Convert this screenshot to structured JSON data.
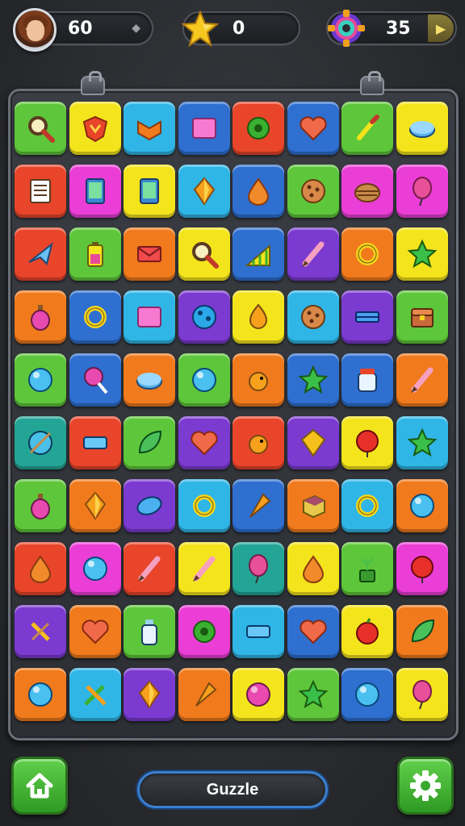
{
  "hud": {
    "player_score": "60",
    "stars_count": "0",
    "coins_count": "35"
  },
  "title": "Guzzle",
  "colors": {
    "green": "#5ec63a",
    "yellow": "#f4e41c",
    "cyan": "#2fb6e6",
    "blue": "#2e6fd0",
    "red": "#e8452a",
    "orange": "#f07a1c",
    "magenta": "#ea3ed6",
    "purple": "#7b3ad0",
    "teal": "#23a596"
  },
  "board": {
    "rows": [
      [
        [
          "green",
          "magnifier"
        ],
        [
          "yellow",
          "emblem"
        ],
        [
          "cyan",
          "chevron"
        ],
        [
          "blue",
          "square-pink"
        ],
        [
          "red",
          "gear"
        ],
        [
          "blue",
          "heart"
        ],
        [
          "green",
          "brush"
        ],
        [
          "yellow",
          "disc"
        ]
      ],
      [
        [
          "red",
          "notepad"
        ],
        [
          "magenta",
          "phone"
        ],
        [
          "yellow",
          "phone"
        ],
        [
          "cyan",
          "gem"
        ],
        [
          "blue",
          "drop"
        ],
        [
          "green",
          "cookie"
        ],
        [
          "magenta",
          "basket"
        ],
        [
          "magenta",
          "balloon"
        ]
      ],
      [
        [
          "red",
          "plane"
        ],
        [
          "green",
          "battery"
        ],
        [
          "orange",
          "envelope"
        ],
        [
          "yellow",
          "magnifier"
        ],
        [
          "blue",
          "chart"
        ],
        [
          "purple",
          "pencil"
        ],
        [
          "orange",
          "ring"
        ],
        [
          "yellow",
          "star"
        ]
      ],
      [
        [
          "orange",
          "potion"
        ],
        [
          "blue",
          "ring"
        ],
        [
          "cyan",
          "square-pink"
        ],
        [
          "purple",
          "ball-dots"
        ],
        [
          "yellow",
          "bulb"
        ],
        [
          "cyan",
          "cookie"
        ],
        [
          "purple",
          "box-flat"
        ],
        [
          "green",
          "chest"
        ]
      ],
      [
        [
          "green",
          "orb"
        ],
        [
          "blue",
          "lollipop"
        ],
        [
          "orange",
          "disc"
        ],
        [
          "green",
          "orb"
        ],
        [
          "orange",
          "bird"
        ],
        [
          "blue",
          "star"
        ],
        [
          "blue",
          "jar"
        ],
        [
          "orange",
          "pencil"
        ]
      ],
      [
        [
          "teal",
          "globe"
        ],
        [
          "red",
          "bar"
        ],
        [
          "green",
          "leaf"
        ],
        [
          "purple",
          "heart"
        ],
        [
          "red",
          "bird"
        ],
        [
          "purple",
          "kite"
        ],
        [
          "yellow",
          "ball-red"
        ],
        [
          "cyan",
          "star"
        ]
      ],
      [
        [
          "green",
          "potion"
        ],
        [
          "orange",
          "gem"
        ],
        [
          "purple",
          "bean"
        ],
        [
          "cyan",
          "ring"
        ],
        [
          "blue",
          "cone"
        ],
        [
          "orange",
          "cube"
        ],
        [
          "cyan",
          "ring"
        ],
        [
          "orange",
          "orb"
        ]
      ],
      [
        [
          "red",
          "drop"
        ],
        [
          "magenta",
          "orb"
        ],
        [
          "red",
          "pencil"
        ],
        [
          "yellow",
          "pencil"
        ],
        [
          "teal",
          "balloon"
        ],
        [
          "yellow",
          "drop"
        ],
        [
          "green",
          "plant"
        ],
        [
          "magenta",
          "ball-red"
        ]
      ],
      [
        [
          "purple",
          "pin"
        ],
        [
          "orange",
          "heart"
        ],
        [
          "green",
          "bottle"
        ],
        [
          "magenta",
          "gear"
        ],
        [
          "cyan",
          "bar"
        ],
        [
          "blue",
          "heart"
        ],
        [
          "yellow",
          "apple"
        ],
        [
          "orange",
          "leaf"
        ]
      ],
      [
        [
          "orange",
          "orb"
        ],
        [
          "cyan",
          "tools"
        ],
        [
          "purple",
          "gem"
        ],
        [
          "orange",
          "cone"
        ],
        [
          "yellow",
          "ball-pink"
        ],
        [
          "green",
          "star"
        ],
        [
          "blue",
          "orb"
        ],
        [
          "yellow",
          "balloon"
        ]
      ]
    ]
  }
}
